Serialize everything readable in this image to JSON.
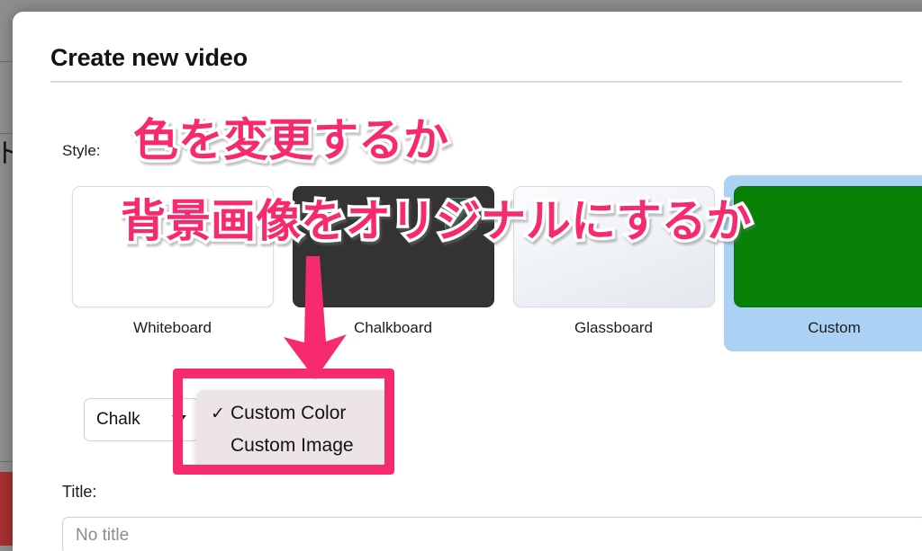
{
  "background": {
    "clipped_glyph": "ト",
    "colors": {
      "page": "#8f8f8f",
      "red_bar": "#a93030"
    }
  },
  "dialog": {
    "title": "Create new video",
    "style_label": "Style:",
    "styles": [
      {
        "label": "Whiteboard",
        "selected": false,
        "thumb": "whiteboard"
      },
      {
        "label": "Chalkboard",
        "selected": false,
        "thumb": "chalkboard"
      },
      {
        "label": "Glassboard",
        "selected": false,
        "thumb": "glassboard"
      },
      {
        "label": "Custom",
        "selected": true,
        "thumb": "custom"
      }
    ],
    "controls": {
      "style_select_value": "Chalk",
      "caret_icon": "chevron-down-icon",
      "color_swatch_value": "#068106"
    },
    "dropdown": {
      "open": true,
      "items": [
        {
          "label": "Custom Color",
          "checked": true,
          "check_glyph": "✓"
        },
        {
          "label": "Custom Image",
          "checked": false,
          "check_glyph": ""
        }
      ]
    },
    "title_field": {
      "label": "Title:",
      "value": "",
      "placeholder": "No title"
    }
  },
  "annotations": {
    "line1": "色を変更するか",
    "line2": "背景画像をオリジナルにするか",
    "accent_color": "#f72a6e",
    "outline_color": "#ffffff",
    "arrow": "down-arrow",
    "highlight_box": "custom-background-menu"
  }
}
